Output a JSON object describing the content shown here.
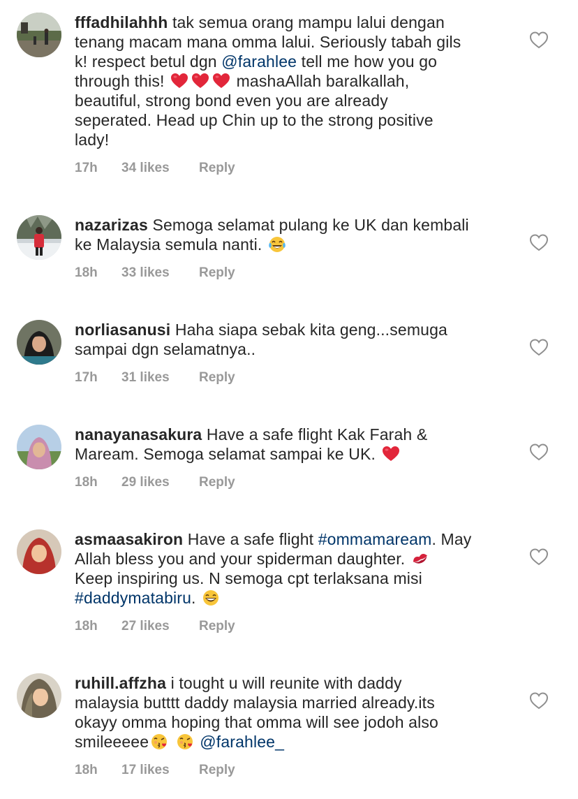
{
  "comments": [
    {
      "username": "fffadhilahhh",
      "time": "17h",
      "likes": "34 likes",
      "reply": "Reply",
      "lines": [
        [
          {
            "t": "tak semua orang mampu lalui dengan"
          }
        ],
        [
          {
            "t": "tenang macam mana omma lalui. Seriously tabah gils"
          }
        ],
        [
          {
            "t": "k! respect betul dgn "
          },
          {
            "t": "@farahlee",
            "k": "mention"
          },
          {
            "t": " tell me how you go"
          }
        ],
        [
          {
            "t": "through this! "
          },
          {
            "e": "red-heart"
          },
          {
            "e": "red-heart"
          },
          {
            "e": "red-heart"
          },
          {
            "t": " mashaAllah baralkallah,"
          }
        ],
        [
          {
            "t": "beautiful, strong bond even you are already"
          }
        ],
        [
          {
            "t": "seperated. Head up Chin up to the strong positive"
          }
        ],
        [
          {
            "t": "lady!"
          }
        ]
      ]
    },
    {
      "username": "nazarizas",
      "time": "18h",
      "likes": "33 likes",
      "reply": "Reply",
      "lines": [
        [
          {
            "t": "Semoga selamat pulang ke UK dan kembali"
          }
        ],
        [
          {
            "t": "ke Malaysia semula nanti. "
          },
          {
            "e": "tears-of-joy"
          }
        ]
      ]
    },
    {
      "username": "norliasanusi",
      "time": "17h",
      "likes": "31 likes",
      "reply": "Reply",
      "lines": [
        [
          {
            "t": "Haha siapa sebak kita geng...semuga"
          }
        ],
        [
          {
            "t": "sampai dgn selamatnya.."
          }
        ]
      ]
    },
    {
      "username": "nanayanasakura",
      "time": "18h",
      "likes": "29 likes",
      "reply": "Reply",
      "lines": [
        [
          {
            "t": "Have a safe flight Kak Farah &"
          }
        ],
        [
          {
            "t": "Maream. Semoga selamat sampai ke UK. "
          },
          {
            "e": "red-heart"
          }
        ]
      ]
    },
    {
      "username": "asmaasakiron",
      "time": "18h",
      "likes": "27 likes",
      "reply": "Reply",
      "lines": [
        [
          {
            "t": "Have a safe flight "
          },
          {
            "t": "#ommamaream",
            "k": "hashtag"
          },
          {
            "t": ". May"
          }
        ],
        [
          {
            "t": "Allah bless you and your spiderman daughter. "
          },
          {
            "e": "kiss-mark"
          }
        ],
        [
          {
            "t": "Keep inspiring us. N semoga cpt terlaksana misi"
          }
        ],
        [
          {
            "t": "#daddymatabiru",
            "k": "hashtag"
          },
          {
            "t": ". "
          },
          {
            "e": "grinning-face"
          }
        ]
      ]
    },
    {
      "username": "ruhill.affzha",
      "time": "18h",
      "likes": "17 likes",
      "reply": "Reply",
      "lines": [
        [
          {
            "t": "i tought u will reunite with daddy"
          }
        ],
        [
          {
            "t": "malaysia  butttt daddy malaysia married already.its"
          }
        ],
        [
          {
            "t": "okayy omma hoping that omma will see jodoh also"
          }
        ],
        [
          {
            "t": "smileeeee"
          },
          {
            "e": "face-blowing-kiss"
          },
          {
            "t": " "
          },
          {
            "e": "face-blowing-kiss"
          },
          {
            "t": " "
          },
          {
            "t": "@farahlee_",
            "k": "mention"
          }
        ]
      ]
    }
  ],
  "icons": {
    "like": "heart-outline-icon"
  },
  "colors": {
    "text": "#262626",
    "meta": "#999999",
    "link": "#003569"
  }
}
